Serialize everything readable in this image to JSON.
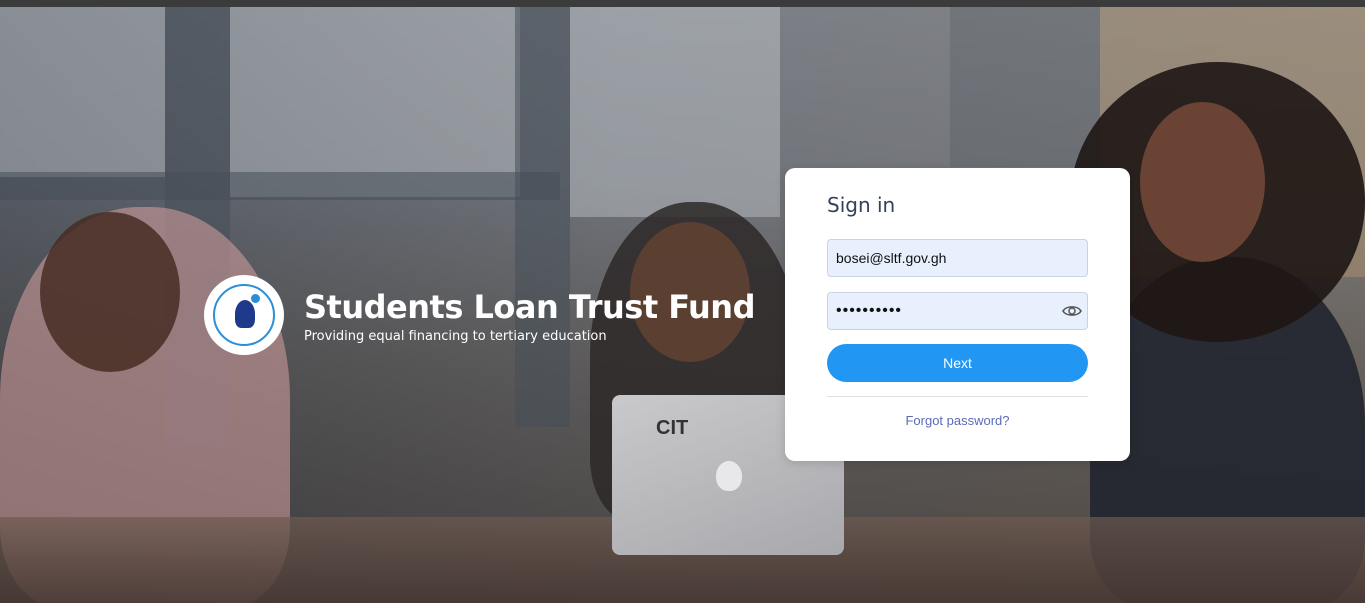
{
  "brand": {
    "name": "Students Loan Trust Fund",
    "tagline": "Providing equal financing to tertiary education",
    "logo_icon": "sltf-logo-icon"
  },
  "background": {
    "laptop_label": "CIT"
  },
  "signin": {
    "title": "Sign in",
    "email_value": "bosei@sltf.gov.gh",
    "password_value": "••••••••••",
    "password_toggle_icon": "eye-icon",
    "next_label": "Next",
    "forgot_label": "Forgot password?"
  },
  "colors": {
    "primary": "#2196f3",
    "link": "#5b6bb5",
    "title": "#33415c",
    "field_bg": "#e8f0fe"
  }
}
